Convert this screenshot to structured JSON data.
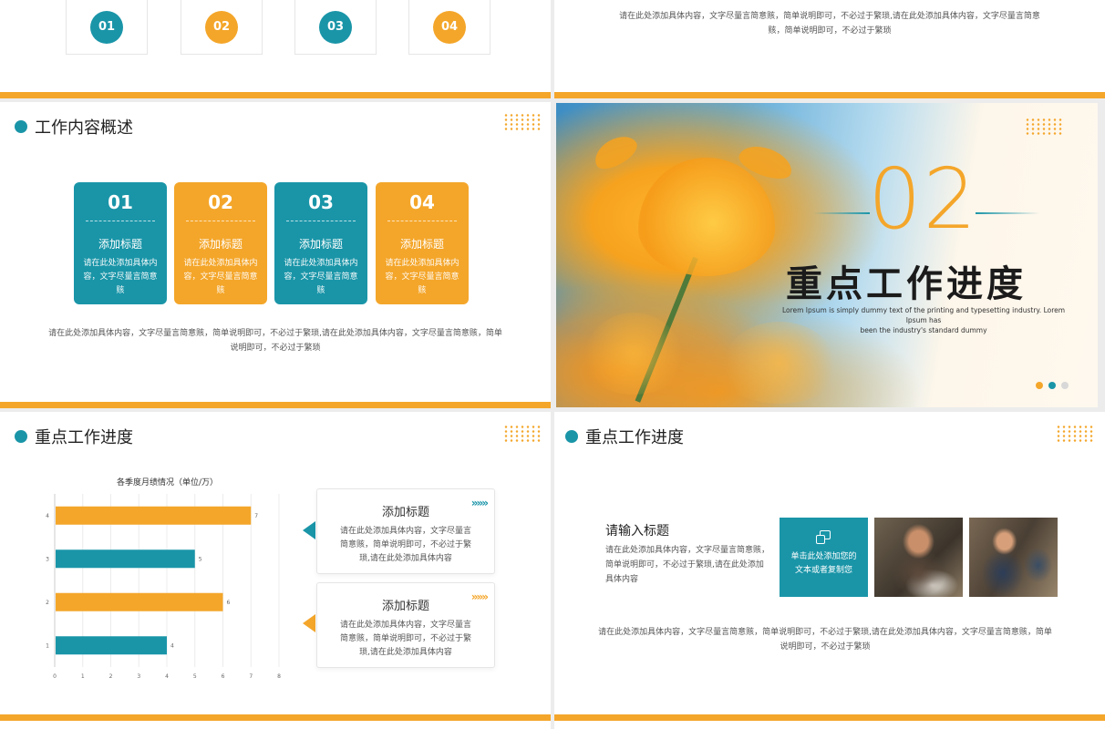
{
  "slide1": {
    "numbers": [
      "01",
      "02",
      "03",
      "04"
    ]
  },
  "slide2": {
    "text_line1": "请在此处添加具体内容，文字尽量言简意赅，简单说明即可，不必过于繁琐,请在此处添加具体内容，文字尽量言简意",
    "text_line2": "赅，简单说明即可，不必过于繁琐"
  },
  "slide3": {
    "title": "工作内容概述",
    "cards": [
      {
        "num": "01",
        "title": "添加标题",
        "desc": "请在此处添加具体内容，文字尽量言简意赅"
      },
      {
        "num": "02",
        "title": "添加标题",
        "desc": "请在此处添加具体内容，文字尽量言简意赅"
      },
      {
        "num": "03",
        "title": "添加标题",
        "desc": "请在此处添加具体内容，文字尽量言简意赅"
      },
      {
        "num": "04",
        "title": "添加标题",
        "desc": "请在此处添加具体内容，文字尽量言简意赅"
      }
    ],
    "text_line1": "请在此处添加具体内容，文字尽量言简意赅，简单说明即可，不必过于繁琐,请在此处添加具体内容，文字尽量言简意赅，简单",
    "text_line2": "说明即可，不必过于繁琐"
  },
  "slide4": {
    "number": "02",
    "title": "重点工作进度",
    "sub_line1": "Lorem Ipsum is simply dummy text of the printing and typesetting industry. Lorem Ipsum has",
    "sub_line2": "been the industry's standard dummy"
  },
  "slide5": {
    "title": "重点工作进度",
    "cards": [
      {
        "title": "添加标题",
        "desc": "请在此处添加具体内容，文字尽量言简意赅，简单说明即可，不必过于繁琐,请在此处添加具体内容"
      },
      {
        "title": "添加标题",
        "desc": "请在此处添加具体内容，文字尽量言简意赅，简单说明即可，不必过于繁琐,请在此处添加具体内容"
      }
    ],
    "chevrons": "»»»"
  },
  "chart_data": {
    "type": "bar",
    "orientation": "horizontal",
    "title": "各季度月绩情况（单位/万）",
    "categories": [
      "1",
      "2",
      "3",
      "4"
    ],
    "values": [
      4,
      6,
      5,
      7
    ],
    "colors": [
      "#1a95a8",
      "#f4a62a",
      "#1a95a8",
      "#f4a62a"
    ],
    "xlim": [
      0,
      8
    ],
    "xticks": [
      0,
      1,
      2,
      3,
      4,
      5,
      6,
      7,
      8
    ],
    "xlabel": "",
    "ylabel": "",
    "grid": true
  },
  "slide6": {
    "title": "重点工作进度",
    "subtitle": "请输入标题",
    "desc": "请在此处添加具体内容，文字尽量言简意赅，简单说明即可，不必过于繁琐,请在此处添加具体内容",
    "box_text": "单击此处添加您的文本或者复制您",
    "text_line1": "请在此处添加具体内容，文字尽量言简意赅，简单说明即可，不必过于繁琐,请在此处添加具体内容，文字尽量言简意赅，简单",
    "text_line2": "说明即可，不必过于繁琐"
  },
  "colors": {
    "teal": "#1a95a8",
    "orange": "#f4a62a"
  }
}
